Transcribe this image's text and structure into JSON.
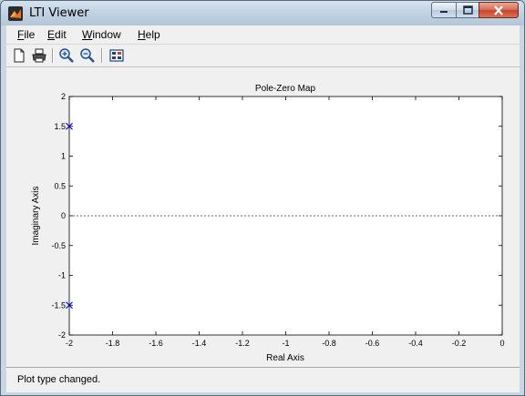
{
  "window": {
    "title": "LTI Viewer",
    "app_icon": "matlab-logo-icon",
    "controls": [
      "minimize-icon",
      "maximize-icon",
      "close-icon"
    ]
  },
  "menu": [
    {
      "label": "File",
      "mnemonic": "F"
    },
    {
      "label": "Edit",
      "mnemonic": "E"
    },
    {
      "label": "Window",
      "mnemonic": "W"
    },
    {
      "label": "Help",
      "mnemonic": "H"
    }
  ],
  "toolbar": {
    "buttons": [
      "new-file-icon",
      "print-icon",
      "zoom-in-icon",
      "zoom-out-icon",
      "plot-configuration-icon"
    ]
  },
  "chart_data": {
    "type": "scatter",
    "title": "Pole-Zero Map",
    "xlabel": "Real Axis",
    "ylabel": "Imaginary Axis",
    "xlim": [
      -2,
      0
    ],
    "ylim": [
      -2,
      2
    ],
    "xticks": [
      -2,
      -1.8,
      -1.6,
      -1.4,
      -1.2,
      -1,
      -0.8,
      -0.6,
      -0.4,
      -0.2,
      0
    ],
    "xtick_labels": [
      "-2",
      "-1.8",
      "-1.6",
      "-1.4",
      "-1.2",
      "-1",
      "-0.8",
      "-0.6",
      "-0.4",
      "-0.2",
      "0"
    ],
    "yticks": [
      2,
      1.5,
      1,
      0.5,
      0,
      -0.5,
      -1,
      -1.5,
      -2
    ],
    "ytick_labels": [
      "2",
      "1.5",
      "1",
      "0.5",
      "0",
      "-0.5",
      "-1",
      "-1.5",
      "-2"
    ],
    "grid": false,
    "reference_line": {
      "y": 0,
      "style": "dashed"
    },
    "series": [
      {
        "marker": "x",
        "color": "#0000cc",
        "points": [
          [
            -2,
            1.5
          ],
          [
            -2,
            -1.5
          ]
        ]
      }
    ]
  },
  "status": {
    "text": "Plot type changed."
  }
}
